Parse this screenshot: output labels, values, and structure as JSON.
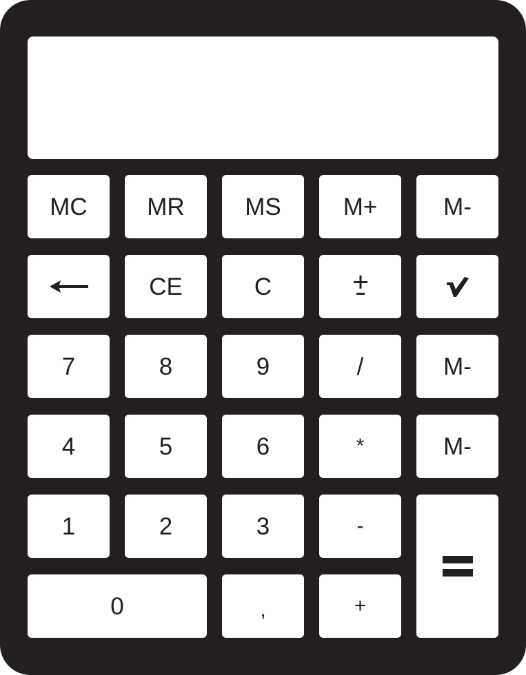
{
  "app": {
    "colors": {
      "body": "#231f20",
      "key": "#ffffff",
      "display": "#ffffff",
      "text": "#231f20"
    }
  },
  "display": {
    "value": ""
  },
  "keys": {
    "mc": "MC",
    "mr": "MR",
    "ms": "MS",
    "m_plus": "M+",
    "m_minus": "M-",
    "backspace": "backspace-arrow-icon",
    "ce": "CE",
    "c": "C",
    "plus_minus": "±",
    "sqrt": "check-mark-icon",
    "seven": "7",
    "eight": "8",
    "nine": "9",
    "divide": "/",
    "m_minus_2": "M-",
    "four": "4",
    "five": "5",
    "six": "6",
    "multiply": "*",
    "m_minus_3": "M-",
    "one": "1",
    "two": "2",
    "three": "3",
    "minus": "-",
    "equals": "equals-icon",
    "zero": "0",
    "comma": ",",
    "plus": "+"
  }
}
